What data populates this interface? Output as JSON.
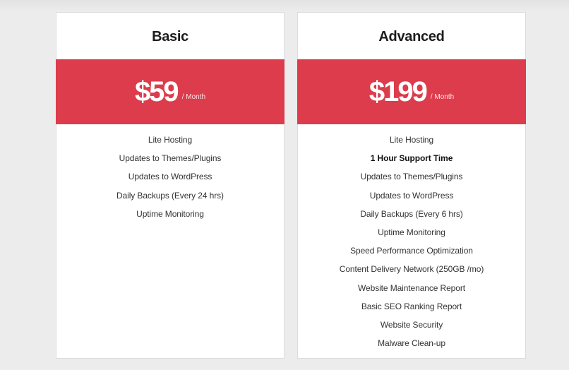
{
  "theme": {
    "accent": "#dc3c4c",
    "background": "#ececec"
  },
  "plans": [
    {
      "name": "Basic",
      "price": "$59",
      "period": "/ Month",
      "features": [
        {
          "label": "Lite Hosting",
          "bold": false
        },
        {
          "label": "Updates to Themes/Plugins",
          "bold": false
        },
        {
          "label": "Updates to WordPress",
          "bold": false
        },
        {
          "label": "Daily Backups (Every 24 hrs)",
          "bold": false
        },
        {
          "label": "Uptime Monitoring",
          "bold": false
        }
      ]
    },
    {
      "name": "Advanced",
      "price": "$199",
      "period": "/ Month",
      "features": [
        {
          "label": "Lite Hosting",
          "bold": false
        },
        {
          "label": "1 Hour Support Time",
          "bold": true
        },
        {
          "label": "Updates to Themes/Plugins",
          "bold": false
        },
        {
          "label": "Updates to WordPress",
          "bold": false
        },
        {
          "label": "Daily Backups (Every 6 hrs)",
          "bold": false
        },
        {
          "label": "Uptime Monitoring",
          "bold": false
        },
        {
          "label": "Speed Performance Optimization",
          "bold": false
        },
        {
          "label": "Content Delivery Network (250GB /mo)",
          "bold": false
        },
        {
          "label": "Website Maintenance Report",
          "bold": false
        },
        {
          "label": "Basic SEO Ranking Report",
          "bold": false
        },
        {
          "label": "Website Security",
          "bold": false
        },
        {
          "label": "Malware Clean-up",
          "bold": false
        }
      ]
    }
  ]
}
